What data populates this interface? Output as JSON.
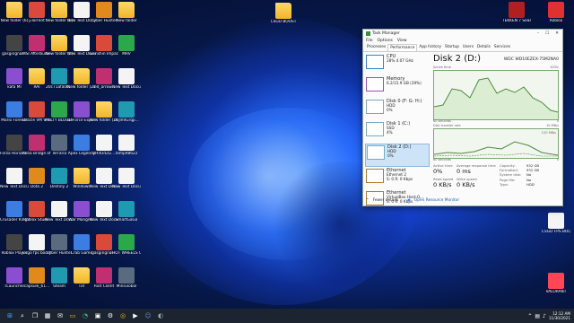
{
  "desktop": {
    "icons_left": [
      {
        "label": "New folder (6)",
        "kind": "folder"
      },
      {
        "label": "µTorrent",
        "kind": "app"
      },
      {
        "label": "New folder (6)",
        "kind": "folder"
      },
      {
        "label": "New Text Document",
        "kind": "doc"
      },
      {
        "label": "Cyber Hunter",
        "kind": "app"
      },
      {
        "label": "New folder",
        "kind": "folder"
      },
      {
        "label": "gasgingnar...",
        "kind": "app"
      },
      {
        "label": "MSI Afterburner",
        "kind": "app"
      },
      {
        "label": "New folder (4)",
        "kind": "folder"
      },
      {
        "label": "New Text Document",
        "kind": "doc"
      },
      {
        "label": "Genshin Impact",
        "kind": "app"
      },
      {
        "label": "MRV",
        "kind": "app"
      },
      {
        "label": "kafa MI",
        "kind": "app"
      },
      {
        "label": "RAI",
        "kind": "folder"
      },
      {
        "label": "20c71afa0b...",
        "kind": "app"
      },
      {
        "label": "New folder (21)",
        "kind": "folder"
      },
      {
        "label": "red_arrow...",
        "kind": "app"
      },
      {
        "label": "New Text Document",
        "kind": "doc"
      },
      {
        "label": "Mario Forever",
        "kind": "app"
      },
      {
        "label": "Oracle VM VirtualBox",
        "kind": "app"
      },
      {
        "label": "MELTY BLOOD TY...",
        "kind": "app"
      },
      {
        "label": "GeForce Experience",
        "kind": "app"
      },
      {
        "label": "New folder (29)",
        "kind": "folder"
      },
      {
        "label": "0cjlmIGrqp...",
        "kind": "app"
      },
      {
        "label": "Forza Horizon 5",
        "kind": "app"
      },
      {
        "label": "Kena Bridge of Spirits",
        "kind": "app"
      },
      {
        "label": "Terraria",
        "kind": "app"
      },
      {
        "label": "Apex Legends",
        "kind": "app"
      },
      {
        "label": "yH4Ud2Li...",
        "kind": "doc"
      },
      {
        "label": "temp98622",
        "kind": "doc"
      },
      {
        "label": "New Text Document",
        "kind": "doc"
      },
      {
        "label": "Dota 2",
        "kind": "app"
      },
      {
        "label": "Destiny 2",
        "kind": "app"
      },
      {
        "label": "Windows",
        "kind": "folder"
      },
      {
        "label": "New Text Document",
        "kind": "doc"
      },
      {
        "label": "New Text Document",
        "kind": "doc"
      },
      {
        "label": "Crusader Kings III Global Offensive",
        "kind": "app"
      },
      {
        "label": "Roblox Studio",
        "kind": "app"
      },
      {
        "label": "New Text Document",
        "kind": "doc"
      },
      {
        "label": "War Mongrels",
        "kind": "app"
      },
      {
        "label": "New Text Document",
        "kind": "doc"
      },
      {
        "label": "SmartGaGa",
        "kind": "app"
      },
      {
        "label": "Roblox Player",
        "kind": "app"
      },
      {
        "label": "Csgo fps boost",
        "kind": "doc"
      },
      {
        "label": "Cyber Hunter",
        "kind": "app"
      },
      {
        "label": "Crab Game",
        "kind": "app"
      },
      {
        "label": "gasgingnar...",
        "kind": "app"
      },
      {
        "label": "HOT WHEELS UNLEASHED",
        "kind": "app"
      },
      {
        "label": "TLauncher",
        "kind": "app"
      },
      {
        "label": "capsule_61...",
        "kind": "app"
      },
      {
        "label": "Steam",
        "kind": "app"
      },
      {
        "label": "Txt",
        "kind": "folder"
      },
      {
        "label": "Riot Client",
        "kind": "app"
      },
      {
        "label": "MiniGlobal",
        "kind": "app"
      }
    ],
    "icons_right": [
      {
        "label": "TEKKEN 7 Season Pass 4",
        "kind": "app"
      },
      {
        "label": "Roblox",
        "kind": "app"
      },
      {
        "label": "CSGO FPS BOOST",
        "kind": "doc"
      },
      {
        "label": "VALORANT",
        "kind": "app"
      }
    ],
    "top_center_folder": "CSGO BOOST"
  },
  "task_manager": {
    "title": "Task Manager",
    "menu": [
      "File",
      "Options",
      "View"
    ],
    "tabs": [
      "Processes",
      "Performance",
      "App history",
      "Startup",
      "Users",
      "Details",
      "Services"
    ],
    "active_tab": "Performance",
    "sidebar": [
      {
        "title": "CPU",
        "line1": "28% 4.07 GHz",
        "line2": ""
      },
      {
        "title": "Memory",
        "line1": "6.2/15.9 GB (39%)",
        "line2": ""
      },
      {
        "title": "Disk 0 (F: G: H:)",
        "line1": "HDD",
        "line2": "0%"
      },
      {
        "title": "Disk 1 (C:)",
        "line1": "SSD",
        "line2": "4%"
      },
      {
        "title": "Disk 2 (D:)",
        "line1": "HDD",
        "line2": "0%"
      },
      {
        "title": "Ethernet",
        "line1": "Ethernet 2",
        "line2": "S: 0 R: 0 Kbps"
      },
      {
        "title": "Ethernet",
        "line1": "VirtualBox Host-O...",
        "line2": "S: 0 R: 0 Kbps"
      }
    ],
    "disk": {
      "heading": "Disk 2 (D:)",
      "model": "WDC WD10EZEX-75M2NA0",
      "graph1_label": "Active time",
      "graph1_max": "100%",
      "graph1_time": "60 seconds",
      "graph1_min": "0",
      "graph2_label": "Disk transfer rate",
      "graph2_max": "10 MB/s",
      "graph2_sub": "120 MB/s",
      "graph2_time": "60 seconds",
      "graph2_min": "0",
      "stats": {
        "active_time_label": "Active time",
        "active_time": "0%",
        "response_label": "Average response time",
        "response": "0 ms",
        "read_label": "Read speed",
        "read": "0 KB/s",
        "write_label": "Write speed",
        "write": "0 KB/s"
      },
      "details": [
        {
          "k": "Capacity:",
          "v": "932 GB"
        },
        {
          "k": "Formatted:",
          "v": "932 GB"
        },
        {
          "k": "System disk:",
          "v": "No"
        },
        {
          "k": "Page file:",
          "v": "No"
        },
        {
          "k": "Type:",
          "v": "HDD"
        }
      ]
    },
    "footer_fewer": "Fewer details",
    "footer_monitor": "Open Resource Monitor"
  },
  "taskbar": {
    "time": "12:12 AM",
    "date": "11/30/2021",
    "icons": [
      "windows-icon",
      "search-icon",
      "task-view-icon",
      "widgets-icon",
      "chat-icon",
      "file-explorer-icon",
      "edge-icon",
      "store-icon",
      "settings-icon",
      "chrome-icon",
      "terminal-icon",
      "discord-icon",
      "steam-icon"
    ]
  },
  "colors": {
    "accent": "#2f6bff",
    "graph_line": "#4f8a3c",
    "graph_fill": "#dbeed4",
    "selection": "#cde3f7"
  }
}
